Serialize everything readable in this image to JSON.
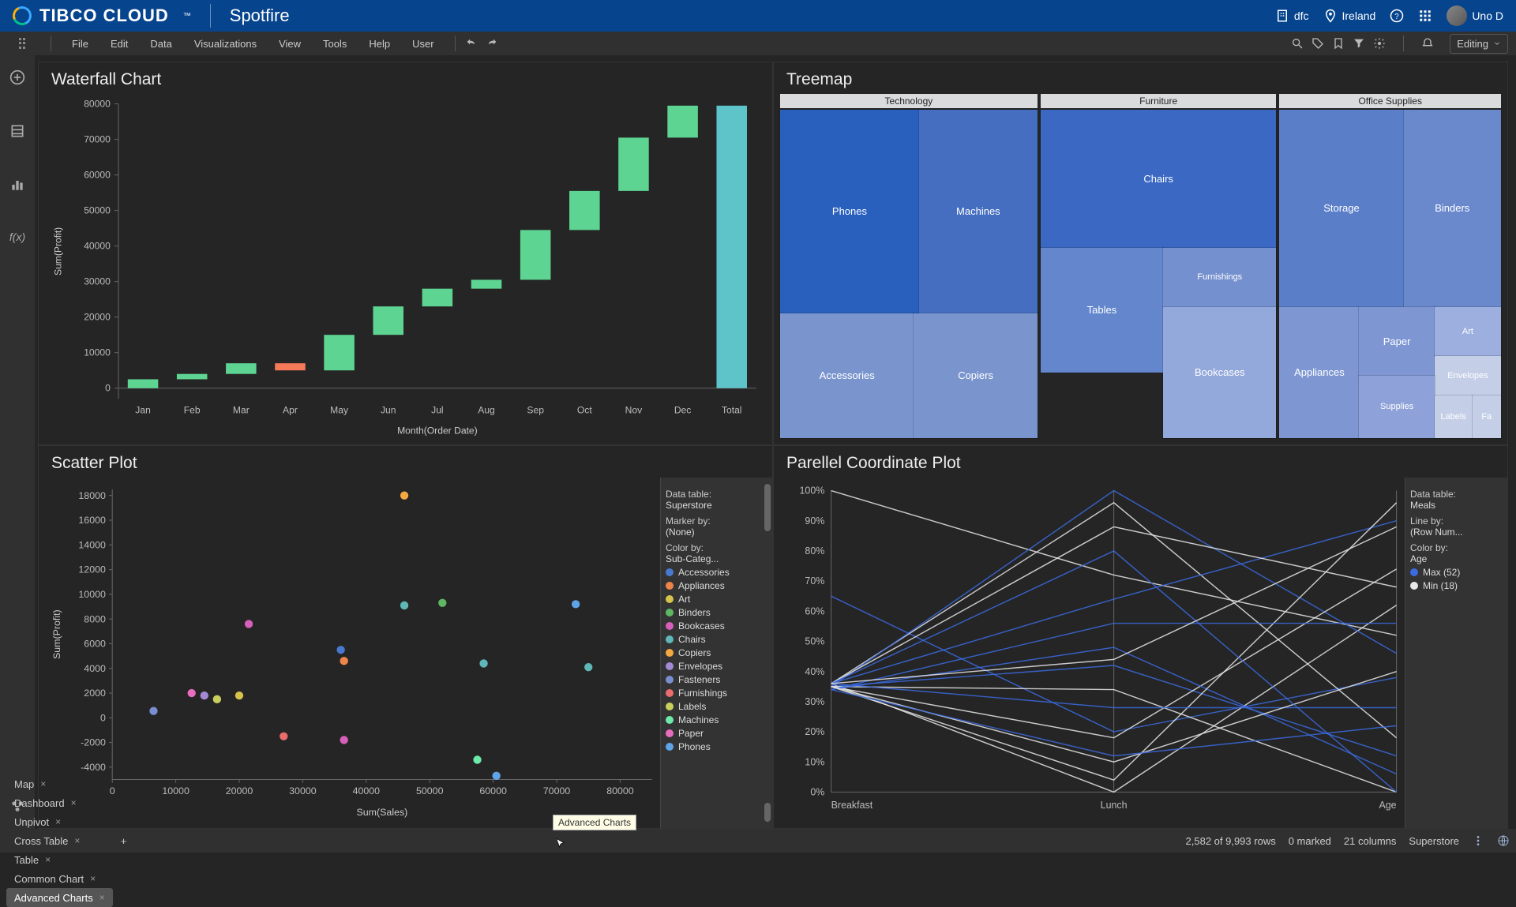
{
  "brand": {
    "cloud": "TIBCO CLOUD",
    "app": "Spotfire"
  },
  "brandRight": {
    "dept": "dfc",
    "loc": "Ireland",
    "user": "Uno D"
  },
  "menu": {
    "items": [
      "File",
      "Edit",
      "Data",
      "Visualizations",
      "View",
      "Tools",
      "Help",
      "User"
    ],
    "mode": "Editing"
  },
  "waterfall": {
    "title": "Waterfall Chart",
    "ylabel": "Sum(Profit)",
    "xlabel": "Month(Order Date)"
  },
  "chart_data": {
    "waterfall": {
      "type": "waterfall",
      "categories": [
        "Jan",
        "Feb",
        "Mar",
        "Apr",
        "May",
        "Jun",
        "Jul",
        "Aug",
        "Sep",
        "Oct",
        "Nov",
        "Dec",
        "Total"
      ],
      "values": [
        2500,
        1500,
        3000,
        -2000,
        10000,
        8000,
        5000,
        2500,
        14000,
        11000,
        15000,
        9000,
        79500
      ],
      "yTicks": [
        0,
        10000,
        20000,
        30000,
        40000,
        50000,
        60000,
        70000,
        80000
      ],
      "ylim": [
        -3000,
        80000
      ]
    },
    "treemap": {
      "type": "treemap",
      "groups": [
        {
          "name": "Technology",
          "share": 0.36,
          "cells": [
            {
              "name": "Phones",
              "size": 0.45,
              "c": "#2960bd"
            },
            {
              "name": "Machines",
              "size": 0.25,
              "c": "#456ec0"
            },
            {
              "name": "Accessories",
              "size": 0.18,
              "c": "#7a94ce"
            },
            {
              "name": "Copiers",
              "size": 0.12,
              "c": "#7a94ce"
            }
          ]
        },
        {
          "name": "Furniture",
          "share": 0.33,
          "cells": [
            {
              "name": "Chairs",
              "size": 0.4,
              "c": "#3a68c2"
            },
            {
              "name": "Tables",
              "size": 0.25,
              "c": "#6386cc"
            },
            {
              "name": "Furnishings",
              "size": 0.14,
              "c": "#7590ce"
            },
            {
              "name": "Bookcases",
              "size": 0.21,
              "c": "#93a8db"
            }
          ]
        },
        {
          "name": "Office Supplies",
          "share": 0.31,
          "cells": [
            {
              "name": "Storage",
              "size": 0.28,
              "c": "#5a7ec8"
            },
            {
              "name": "Binders",
              "size": 0.22,
              "c": "#6a89cd"
            },
            {
              "name": "Appliances",
              "size": 0.13,
              "c": "#7e97d2"
            },
            {
              "name": "Paper",
              "size": 0.1,
              "c": "#7e97d2"
            },
            {
              "name": "Art",
              "size": 0.07,
              "c": "#9dafde"
            },
            {
              "name": "Envelopes",
              "size": 0.05,
              "c": "#c4cee7"
            },
            {
              "name": "Supplies",
              "size": 0.08,
              "c": "#8ea1d8"
            },
            {
              "name": "Labels",
              "size": 0.04,
              "c": "#c4cee7"
            },
            {
              "name": "Fa",
              "size": 0.03,
              "c": "#c4cee7"
            }
          ]
        }
      ]
    },
    "scatter": {
      "type": "scatter",
      "xTicks": [
        0,
        10000,
        20000,
        30000,
        40000,
        50000,
        60000,
        70000,
        80000
      ],
      "yTicks": [
        -4000,
        -2000,
        0,
        2000,
        4000,
        6000,
        8000,
        10000,
        12000,
        14000,
        16000,
        18000
      ],
      "xlim": [
        0,
        85000
      ],
      "ylim": [
        -5000,
        18500
      ],
      "xlabel": "Sum(Sales)",
      "ylabel": "Sum(Profit)",
      "points": [
        {
          "x": 46000,
          "y": 18000,
          "cat": "Copiers"
        },
        {
          "x": 52000,
          "y": 9300,
          "cat": "Binders"
        },
        {
          "x": 73000,
          "y": 9200,
          "cat": "Phones"
        },
        {
          "x": 46000,
          "y": 9100,
          "cat": "Chairs"
        },
        {
          "x": 21500,
          "y": 7600,
          "cat": "Bookcases"
        },
        {
          "x": 36000,
          "y": 5500,
          "cat": "Accessories"
        },
        {
          "x": 36500,
          "y": 4600,
          "cat": "Appliances"
        },
        {
          "x": 75000,
          "y": 4100,
          "cat": "Chairs"
        },
        {
          "x": 58500,
          "y": 4400,
          "cat": "Chairs"
        },
        {
          "x": 12500,
          "y": 2000,
          "cat": "Paper"
        },
        {
          "x": 20000,
          "y": 1800,
          "cat": "Art"
        },
        {
          "x": 16500,
          "y": 1500,
          "cat": "Labels"
        },
        {
          "x": 14500,
          "y": 1800,
          "cat": "Envelopes"
        },
        {
          "x": 6500,
          "y": 550,
          "cat": "Fasteners"
        },
        {
          "x": 27000,
          "y": -1500,
          "cat": "Furnishings"
        },
        {
          "x": 36500,
          "y": -1800,
          "cat": "Bookcases"
        },
        {
          "x": 57500,
          "y": -3400,
          "cat": "Machines"
        },
        {
          "x": 60500,
          "y": -4700,
          "cat": "Phones"
        }
      ]
    },
    "parallel": {
      "type": "parallel",
      "axes": [
        "Breakfast",
        "Lunch",
        "Age"
      ],
      "yTicks": [
        "0%",
        "10%",
        "20%",
        "30%",
        "40%",
        "50%",
        "60%",
        "70%",
        "80%",
        "90%",
        "100%"
      ],
      "lines": [
        {
          "c": "white",
          "v": [
            100,
            72,
            52
          ]
        },
        {
          "c": "blue",
          "v": [
            65,
            20,
            38
          ]
        },
        {
          "c": "white",
          "v": [
            36,
            0,
            62
          ]
        },
        {
          "c": "blue",
          "v": [
            35,
            42,
            12
          ]
        },
        {
          "c": "white",
          "v": [
            36,
            96,
            18
          ]
        },
        {
          "c": "blue",
          "v": [
            35,
            100,
            46
          ]
        },
        {
          "c": "white",
          "v": [
            35,
            34,
            0
          ]
        },
        {
          "c": "blue",
          "v": [
            36,
            64,
            90
          ]
        },
        {
          "c": "white",
          "v": [
            35,
            18,
            74
          ]
        },
        {
          "c": "blue",
          "v": [
            34,
            48,
            6
          ]
        },
        {
          "c": "white",
          "v": [
            35,
            4,
            96
          ]
        },
        {
          "c": "blue",
          "v": [
            36,
            28,
            28
          ]
        },
        {
          "c": "white",
          "v": [
            36,
            88,
            68
          ]
        },
        {
          "c": "blue",
          "v": [
            34,
            56,
            56
          ]
        },
        {
          "c": "white",
          "v": [
            35,
            10,
            40
          ]
        },
        {
          "c": "blue",
          "v": [
            36,
            80,
            0
          ]
        },
        {
          "c": "white",
          "v": [
            36,
            44,
            88
          ]
        },
        {
          "c": "blue",
          "v": [
            34,
            12,
            22
          ]
        }
      ],
      "legend": {
        "dt": "Data table:",
        "dtv": "Meals",
        "lb": "Line by:",
        "lbv": "(Row Num...",
        "cb": "Color by:",
        "cbv": "Age",
        "max": "Max (52)",
        "min": "Min (18)"
      }
    }
  },
  "scatter": {
    "title": "Scatter Plot",
    "legend": {
      "dt": "Data table:",
      "dtv": "Superstore",
      "mb": "Marker by:",
      "mbv": "(None)",
      "cb": "Color by:",
      "cbv": "Sub-Categ...",
      "items": [
        {
          "name": "Accessories",
          "c": "#4878d0"
        },
        {
          "name": "Appliances",
          "c": "#ee854a"
        },
        {
          "name": "Art",
          "c": "#d5c34b"
        },
        {
          "name": "Binders",
          "c": "#5fb763"
        },
        {
          "name": "Bookcases",
          "c": "#d65fba"
        },
        {
          "name": "Chairs",
          "c": "#5fb7b7"
        },
        {
          "name": "Copiers",
          "c": "#f5a742"
        },
        {
          "name": "Envelopes",
          "c": "#a48ad4"
        },
        {
          "name": "Fasteners",
          "c": "#7a8ecf"
        },
        {
          "name": "Furnishings",
          "c": "#e96d6d"
        },
        {
          "name": "Labels",
          "c": "#c9cf5f"
        },
        {
          "name": "Machines",
          "c": "#6de9a8"
        },
        {
          "name": "Paper",
          "c": "#e96dbf"
        },
        {
          "name": "Phones",
          "c": "#5fa4e9"
        }
      ]
    }
  },
  "treemap": {
    "title": "Treemap"
  },
  "parallel": {
    "title": "Parellel Coordinate Plot"
  },
  "tabs": [
    "Map",
    "Dashboard",
    "Unpivot",
    "Cross Table",
    "Table",
    "Common Chart",
    "Advanced Charts"
  ],
  "tooltip": "Advanced Charts",
  "status": {
    "rows": "2,582 of 9,993 rows",
    "marked": "0 marked",
    "cols": "21 columns",
    "tbl": "Superstore"
  }
}
